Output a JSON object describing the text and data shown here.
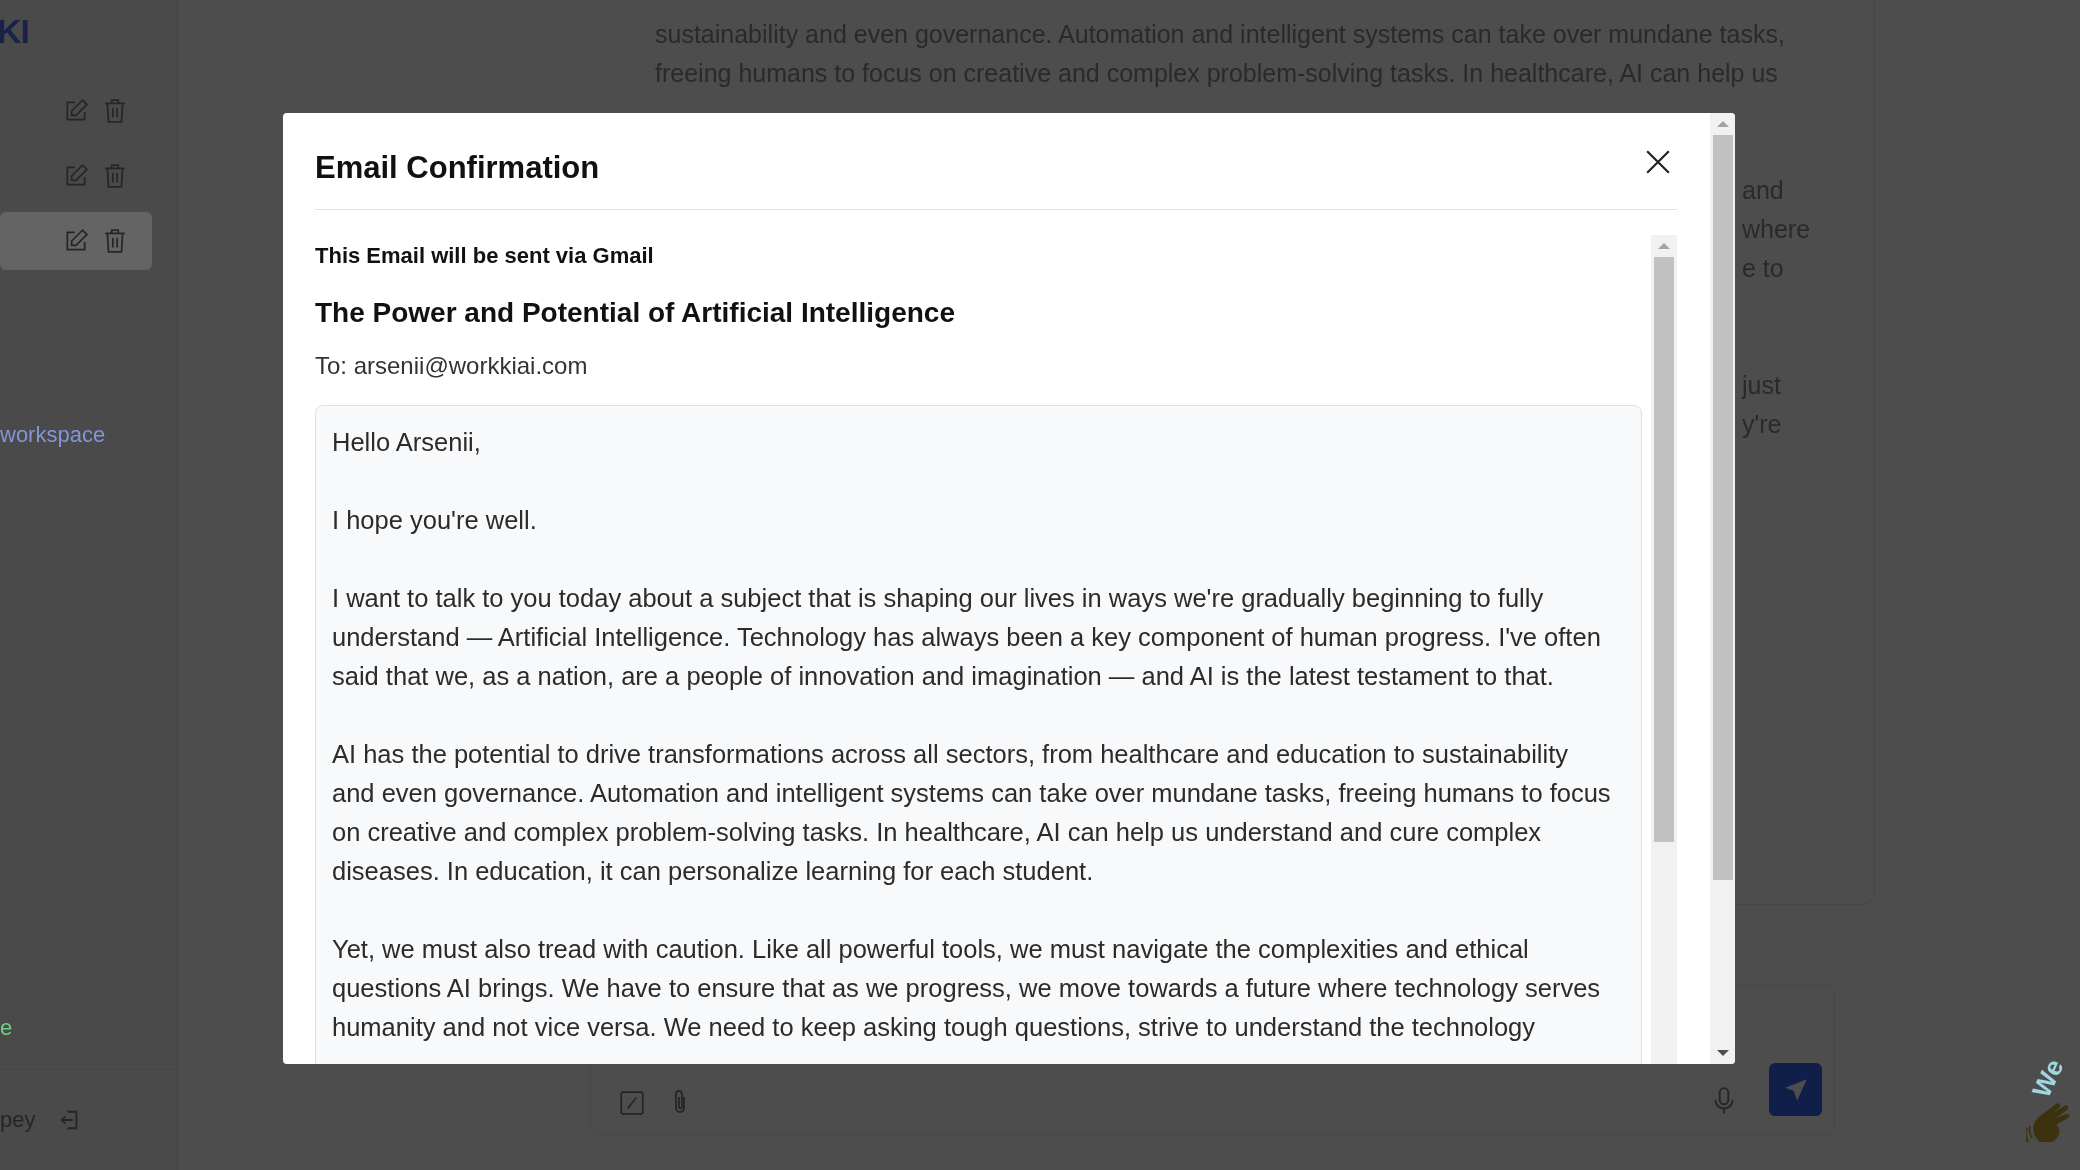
{
  "sidebar": {
    "logo": "KI",
    "chats": [
      {
        "selected": false
      },
      {
        "selected": false
      },
      {
        "selected": true
      }
    ],
    "workspace_link": "workspace",
    "status_text": "e",
    "user_name": "pey"
  },
  "background_message": {
    "lines": [
      "sustainability and even governance. Automation and intelligent systems can take over mundane tasks,",
      "freeing humans to focus on creative and complex problem-solving tasks. In healthcare, AI can help us"
    ],
    "fragments": [
      [
        "and",
        "where",
        "e to"
      ],
      [
        "just",
        "y're"
      ]
    ]
  },
  "badge": {
    "text": "We"
  },
  "modal": {
    "title": "Email Confirmation",
    "notice": "This Email will be sent via Gmail",
    "subject": "The Power and Potential of Artificial Intelligence",
    "to": "To: arsenii@workkiai.com",
    "body_paragraphs": [
      [
        "Hello Arsenii,"
      ],
      [
        "I hope you're well."
      ],
      [
        "I want to talk to you today about a subject that is shaping our lives in ways we're gradually beginning to fully",
        "understand — Artificial Intelligence. Technology has always been a key component of human progress. I've often",
        "said that we, as a nation, are a people of innovation and imagination — and AI is the latest testament to that."
      ],
      [
        "AI has the potential to drive transformations across all sectors, from healthcare and education to sustainability",
        "and even governance. Automation and intelligent systems can take over mundane tasks, freeing humans to focus",
        "on creative and complex problem-solving tasks. In healthcare, AI can help us understand and cure complex",
        "diseases. In education, it can personalize learning for each student."
      ],
      [
        "Yet, we must also tread with caution. Like all powerful tools, we must navigate the complexities and ethical",
        "questions AI brings. We have to ensure that as we progress, we move towards a future where technology serves",
        "humanity and not vice versa. We need to keep asking tough questions, strive to understand the technology"
      ]
    ]
  }
}
